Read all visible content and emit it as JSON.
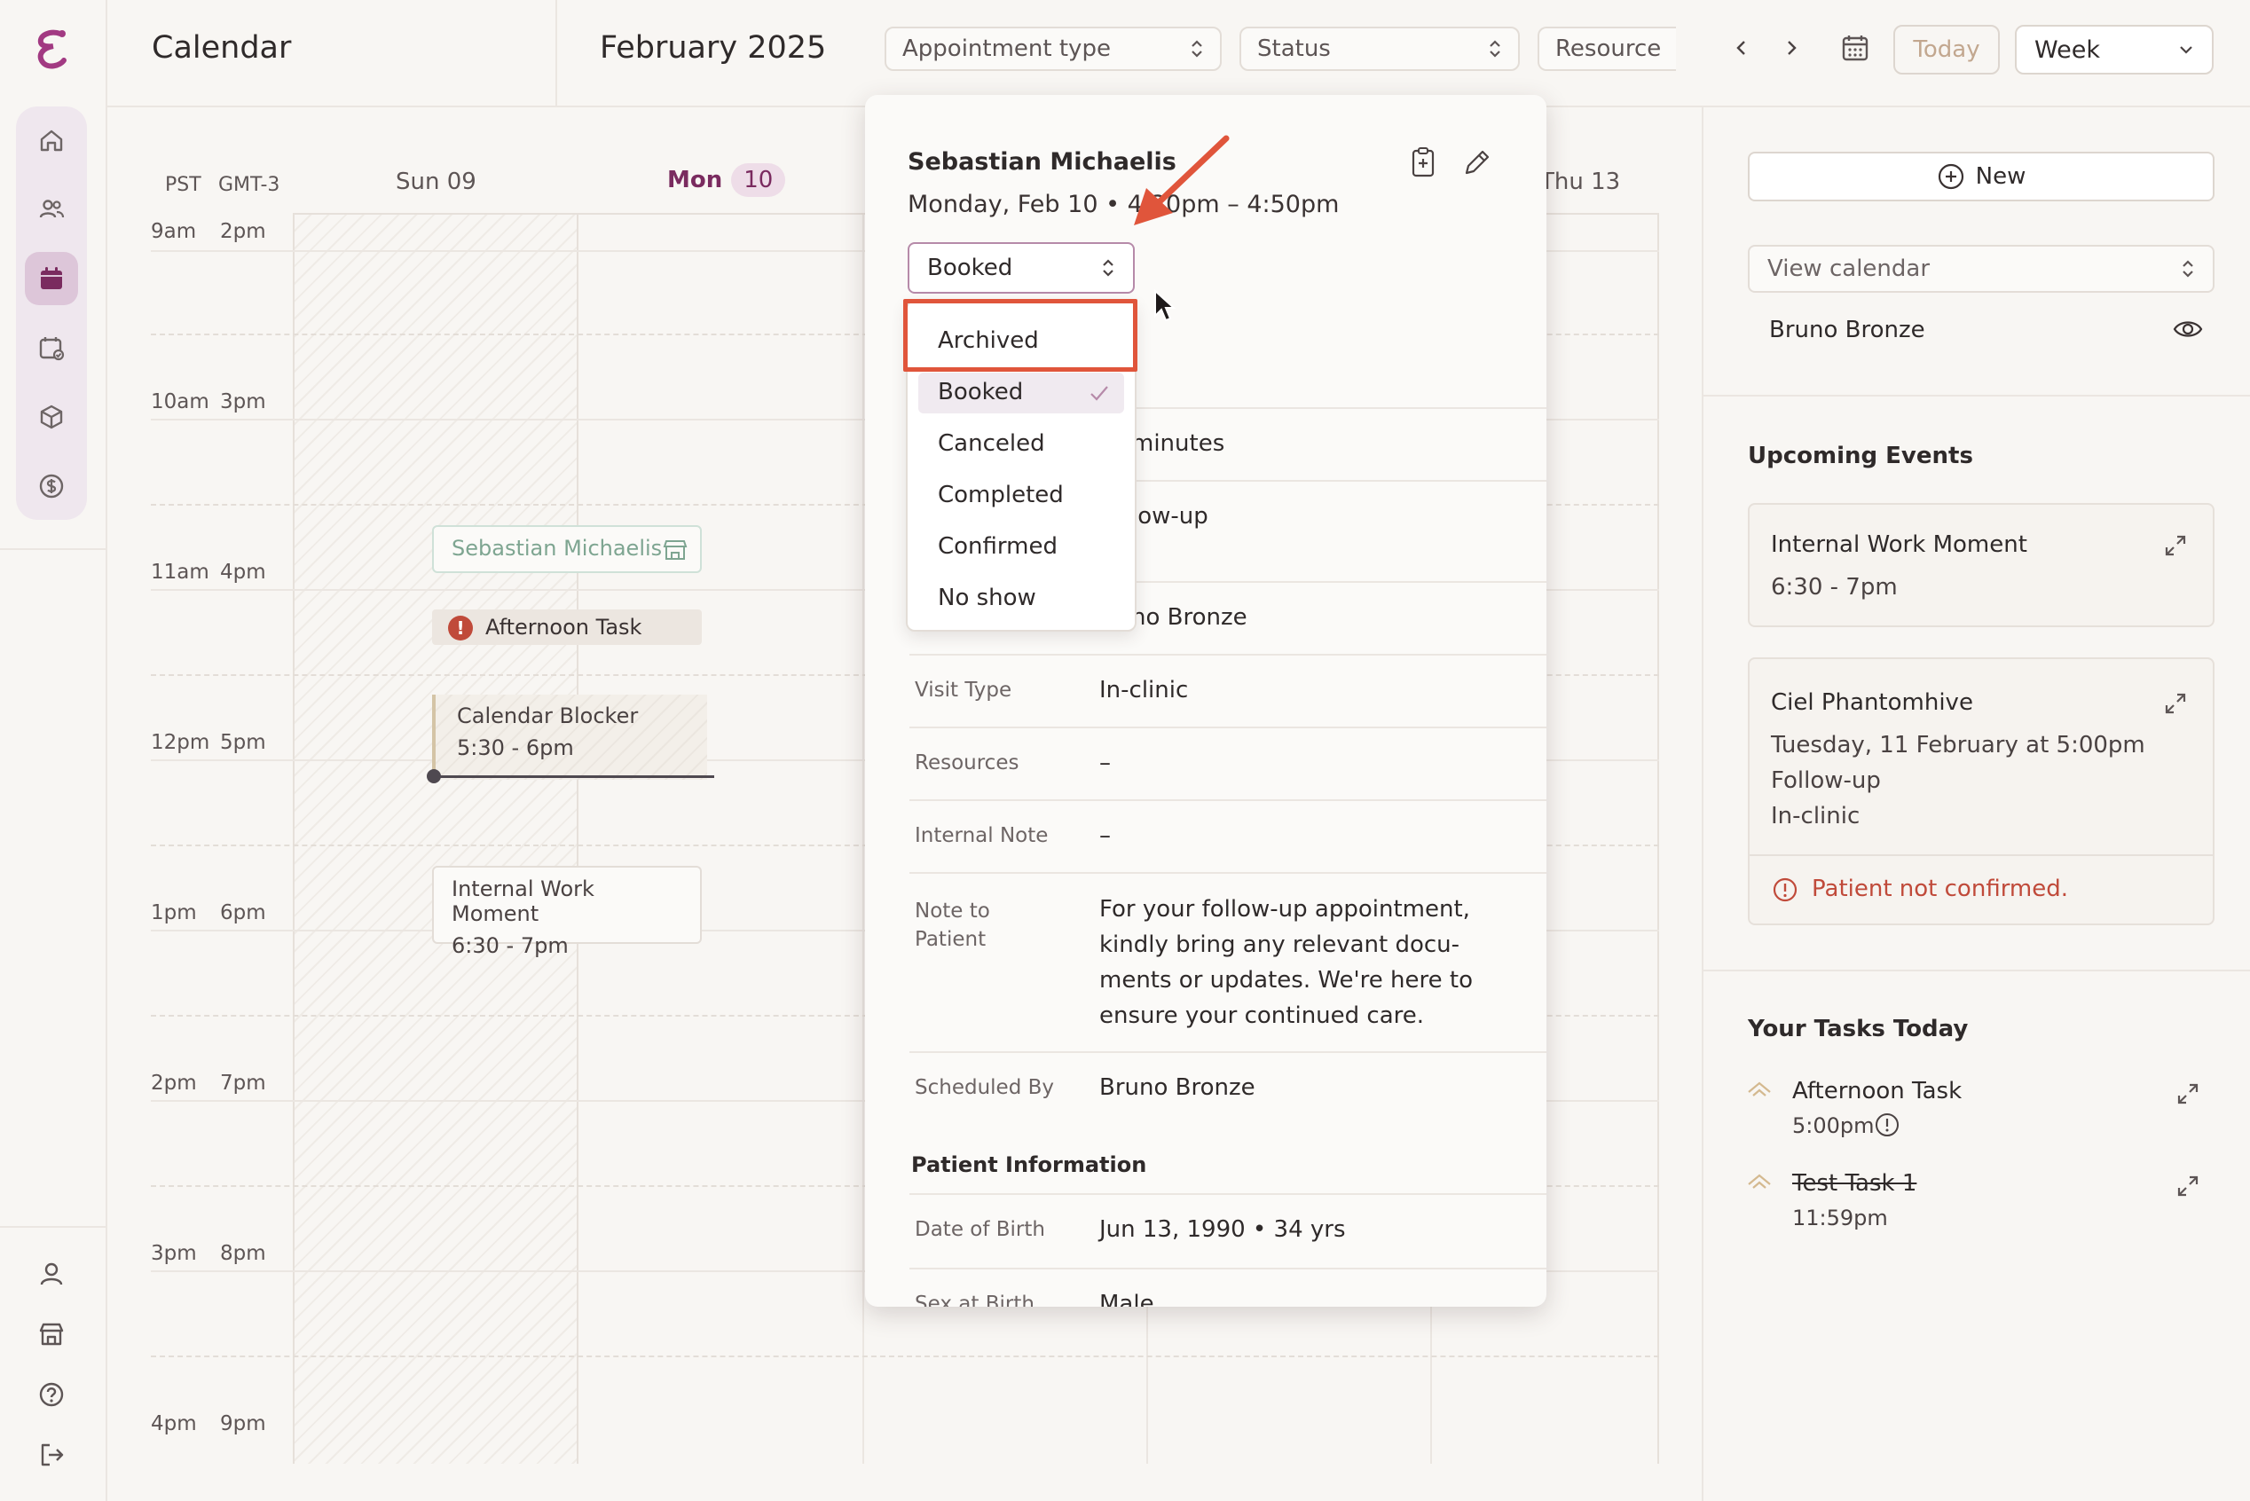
{
  "app": {
    "title": "Calendar"
  },
  "header": {
    "month": "February 2025",
    "filters": [
      {
        "label": "Appointment type"
      },
      {
        "label": "Status"
      },
      {
        "label": "Resource"
      }
    ],
    "today_label": "Today",
    "view_value": "Week"
  },
  "calendar": {
    "tz_left": "PST",
    "tz_right": "GMT-3",
    "days": [
      {
        "label": "Sun 09"
      },
      {
        "label": "Mon",
        "date": "10"
      },
      {
        "label": "Thu 13"
      }
    ],
    "times": [
      {
        "left": "9am",
        "right": "2pm"
      },
      {
        "left": "10am",
        "right": "3pm"
      },
      {
        "left": "11am",
        "right": "4pm"
      },
      {
        "left": "12pm",
        "right": "5pm"
      },
      {
        "left": "1pm",
        "right": "6pm"
      },
      {
        "left": "2pm",
        "right": "7pm"
      },
      {
        "left": "3pm",
        "right": "8pm"
      },
      {
        "left": "4pm",
        "right": "9pm"
      }
    ],
    "events": {
      "sebastian": "Sebastian Michaelis",
      "task": "Afternoon Task",
      "blocker_title": "Calendar Blocker",
      "blocker_time": "5:30 - 6pm",
      "internal_title": "Internal Work Moment",
      "internal_time": "6:30 - 7pm"
    }
  },
  "popover": {
    "patient_name": "Sebastian Michaelis",
    "when": "Monday, Feb 10 • 4:30pm – 4:50pm",
    "status_value": "Booked",
    "partial_duration": "minutes",
    "partial_type": "low-up",
    "partial_provider": "no Bronze",
    "rows": [
      {
        "label": "Visit Type",
        "value": "In-clinic"
      },
      {
        "label": "Resources",
        "value": "–"
      },
      {
        "label": "Internal Note",
        "value": "–"
      },
      {
        "label": "Note to Patient",
        "value": "For your follow-up appointment, kindly bring any relevant docu-ments or updates. We're here to ensure your continued care."
      },
      {
        "label": "Scheduled By",
        "value": "Bruno Bronze"
      }
    ],
    "patient_section": "Patient Information",
    "dob_label": "Date of Birth",
    "dob_value": "Jun 13, 1990 • 34 yrs",
    "sex_label": "Sex at Birth",
    "sex_value": "Male"
  },
  "status_dropdown": {
    "options": [
      "Archived",
      "Booked",
      "Canceled",
      "Completed",
      "Confirmed",
      "No show"
    ],
    "selected": "Booked",
    "highlighted": "Archived",
    "highlight_color": "#e0553b"
  },
  "sidebar": {
    "new_label": "New",
    "view_calendar_placeholder": "View calendar",
    "calendar_owner": "Bruno Bronze",
    "upcoming_heading": "Upcoming Events",
    "upcoming": [
      {
        "title": "Internal Work Moment",
        "time": "6:30 - 7pm"
      },
      {
        "title": "Ciel Phantomhive",
        "date": "Tuesday, 11 February at 5:00pm",
        "type": "Follow-up",
        "visit": "In-clinic",
        "alert": "Patient not confirmed."
      }
    ],
    "tasks_heading": "Your Tasks Today",
    "tasks": [
      {
        "title": "Afternoon Task",
        "time": "5:00pm"
      },
      {
        "title": "Test Task 1",
        "time": "11:59pm",
        "done": true
      }
    ]
  },
  "colors": {
    "accent": "#7a2b5f",
    "annotation": "#e0553b",
    "alert": "#c04a3a"
  }
}
